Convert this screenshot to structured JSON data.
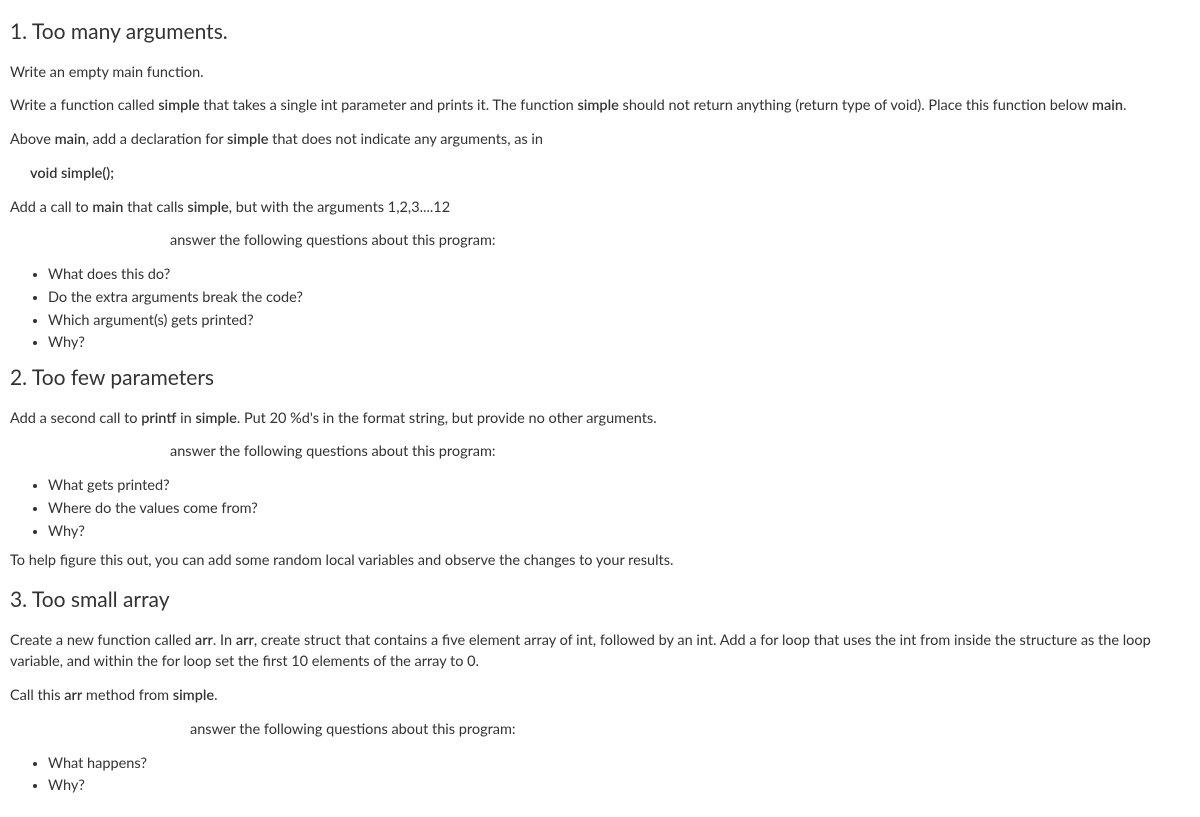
{
  "section1": {
    "heading": "1. Too many arguments.",
    "p1_pre": "Write an empty main function.",
    "p2_pre": "Write a function called ",
    "p2_b1": "simple",
    "p2_mid1": " that takes a single int parameter and prints it. The function ",
    "p2_b2": "simple",
    "p2_mid2": " should not return anything (return type of void). Place this function below ",
    "p2_b3": "main",
    "p2_end": ".",
    "p3_pre": "Above ",
    "p3_b1": "main",
    "p3_mid": ", add a declaration for ",
    "p3_b2": "simple",
    "p3_end": " that does not indicate any arguments, as in",
    "code": "void simple();",
    "p4_pre": "Add a call to ",
    "p4_b1": "main",
    "p4_mid": " that calls ",
    "p4_b2": "simple",
    "p4_end": ", but with the arguments 1,2,3....12",
    "prompt": "answer the following questions about this program:",
    "questions": [
      "What does this do?",
      "Do the extra arguments break the code?",
      "Which argument(s) gets printed?",
      "Why?"
    ]
  },
  "section2": {
    "heading": "2. Too few parameters",
    "p1_pre": "Add a second call to ",
    "p1_b1": "printf",
    "p1_mid": " in ",
    "p1_b2": "simple",
    "p1_end": ". Put 20 %d's in the format string, but provide no other arguments.",
    "prompt": "answer the following questions about this program:",
    "questions": [
      "What gets printed?",
      "Where do the values come from?",
      "Why?"
    ],
    "hint": "To help figure this out, you can add some random local variables and observe the changes to your results."
  },
  "section3": {
    "heading": "3. Too small array",
    "p1_pre": "Create a new function called ",
    "p1_b1": "arr",
    "p1_mid1": ". In ",
    "p1_b2": "arr",
    "p1_mid2": ", create struct that contains a five element array of int, followed by an int.   Add a for loop that uses the int from inside the structure as the loop variable, and within the for loop set the first 10 elements of the array to 0.",
    "p2_pre": "Call this ",
    "p2_b1": "arr",
    "p2_mid": " method from ",
    "p2_b2": "simple",
    "p2_end": ".",
    "prompt": "answer the following questions about this program:",
    "questions": [
      "What happens?",
      "Why?"
    ]
  }
}
